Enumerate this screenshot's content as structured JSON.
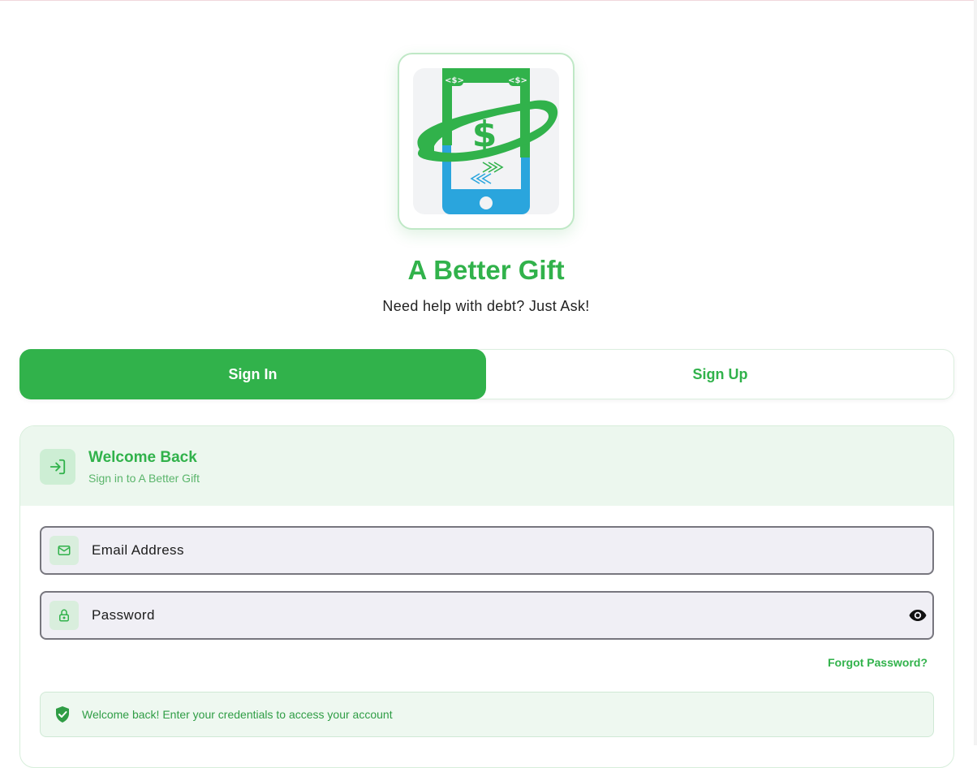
{
  "app": {
    "title": "A Better Gift",
    "tagline": "Need help with debt? Just Ask!"
  },
  "tabs": [
    {
      "label": "Sign In",
      "active": true
    },
    {
      "label": "Sign Up",
      "active": false
    }
  ],
  "card": {
    "title": "Welcome Back",
    "subtitle": "Sign in to A Better Gift",
    "icon": "login-icon"
  },
  "fields": {
    "email": {
      "placeholder": "Email Address",
      "value": "",
      "icon": "mail-icon"
    },
    "password": {
      "placeholder": "Password",
      "value": "",
      "icon": "lock-icon",
      "toggle_icon": "eye-icon"
    }
  },
  "forgot_password": "Forgot Password?",
  "info": {
    "text": "Welcome back! Enter your credentials to access your account",
    "icon": "shield-check-icon"
  },
  "colors": {
    "brand_green": "#31b24b",
    "logo_blue": "#2aa5dd",
    "field_bg": "#f0eff5",
    "header_bg": "#ecf7ee"
  }
}
